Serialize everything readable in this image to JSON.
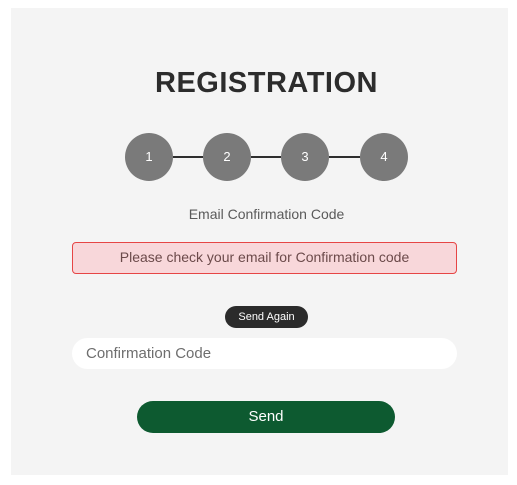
{
  "page": {
    "title": "REGISTRATION"
  },
  "stepper": {
    "steps": [
      "1",
      "2",
      "3",
      "4"
    ]
  },
  "form": {
    "subtitle": "Email Confirmation Code",
    "alert_message": "Please check your email for Confirmation code",
    "send_again_label": "Send Again",
    "code_placeholder": "Confirmation Code",
    "code_value": "",
    "send_label": "Send"
  },
  "colors": {
    "primary": "#0d5a30",
    "step_circle": "#7a7a7a",
    "alert_border": "#e64545",
    "alert_background": "#f8d7da"
  }
}
